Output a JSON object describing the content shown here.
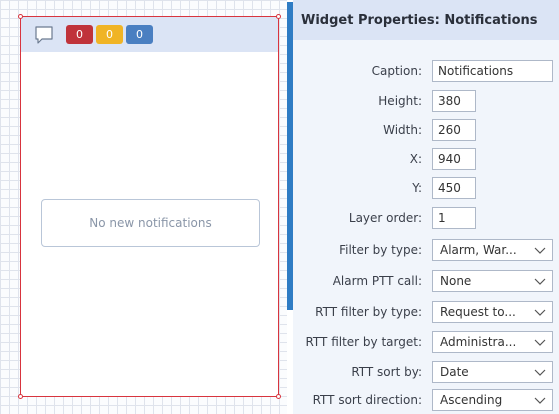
{
  "canvas": {
    "widget": {
      "badges": [
        {
          "value": "0",
          "color": "#c0333a"
        },
        {
          "value": "0",
          "color": "#f0b425"
        },
        {
          "value": "0",
          "color": "#4a7fc1"
        }
      ],
      "empty_message": "No new notifications"
    }
  },
  "panel": {
    "title": "Widget Properties: Notifications",
    "fields": {
      "caption": {
        "label": "Caption:",
        "value": "Notifications"
      },
      "height": {
        "label": "Height:",
        "value": "380"
      },
      "width": {
        "label": "Width:",
        "value": "260"
      },
      "x": {
        "label": "X:",
        "value": "940"
      },
      "y": {
        "label": "Y:",
        "value": "450"
      },
      "layer_order": {
        "label": "Layer order:",
        "value": "1"
      },
      "filter_by_type": {
        "label": "Filter by type:",
        "value": "Alarm, War..."
      },
      "alarm_ptt_call": {
        "label": "Alarm PTT call:",
        "value": "None"
      },
      "rtt_filter_by_type": {
        "label": "RTT filter by type:",
        "value": "Request to..."
      },
      "rtt_filter_by_target": {
        "label": "RTT filter by target:",
        "value": "Administra..."
      },
      "rtt_sort_by": {
        "label": "RTT sort by:",
        "value": "Date"
      },
      "rtt_sort_direction": {
        "label": "RTT sort direction:",
        "value": "Ascending"
      }
    }
  },
  "colors": {
    "accent": "#2f7cc4",
    "selection_border": "#d8343e",
    "header_bg": "#dbe4f5"
  }
}
